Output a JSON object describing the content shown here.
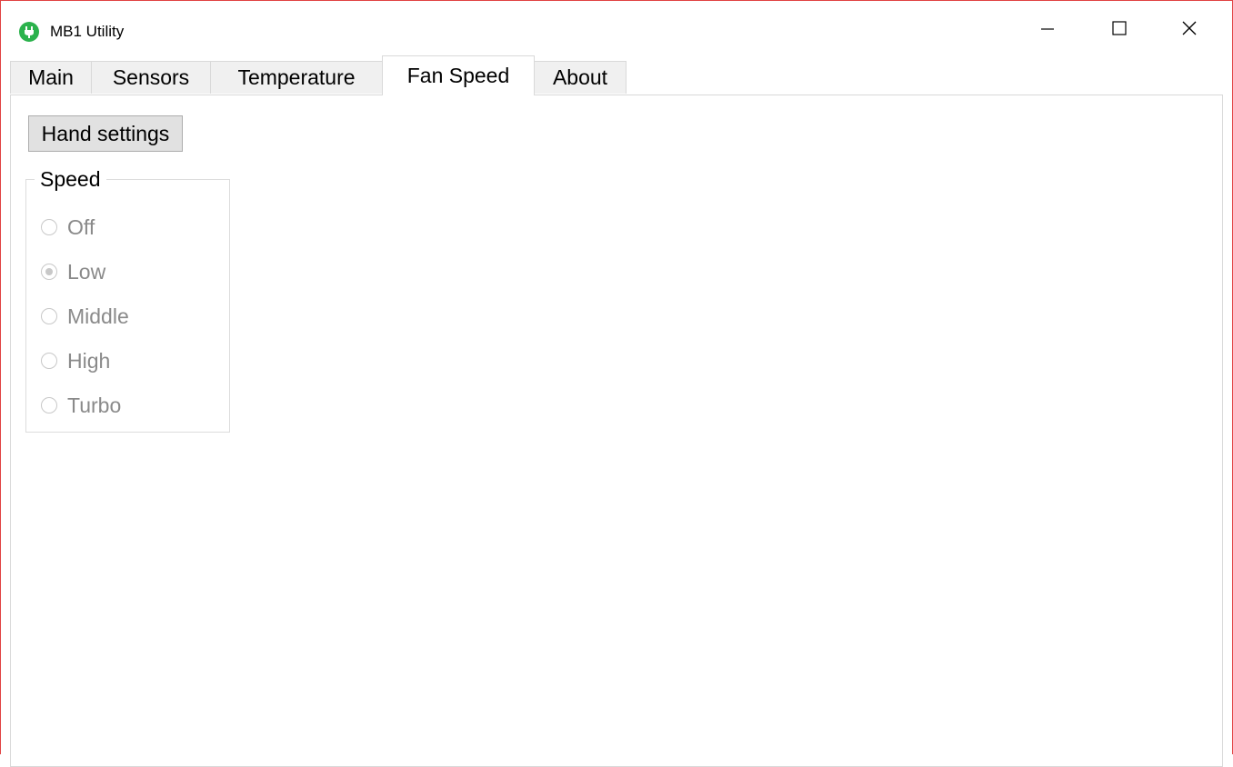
{
  "window": {
    "title": "MB1 Utility",
    "buttons": {
      "minimize": "minimize-icon",
      "maximize": "maximize-icon",
      "close": "close-icon"
    },
    "border_color": "#e04343",
    "app_icon_color": "#2bb24c"
  },
  "tabs": [
    {
      "label": "Main",
      "active": false
    },
    {
      "label": "Sensors",
      "active": false
    },
    {
      "label": "Temperature",
      "active": false
    },
    {
      "label": "Fan Speed",
      "active": true
    },
    {
      "label": "About",
      "active": false
    }
  ],
  "fan_speed": {
    "hand_settings_label": "Hand settings",
    "group_title": "Speed",
    "options": [
      {
        "label": "Off",
        "checked": false,
        "enabled": false
      },
      {
        "label": "Low",
        "checked": true,
        "enabled": false
      },
      {
        "label": "Middle",
        "checked": false,
        "enabled": false
      },
      {
        "label": "High",
        "checked": false,
        "enabled": false
      },
      {
        "label": "Turbo",
        "checked": false,
        "enabled": false
      }
    ]
  }
}
